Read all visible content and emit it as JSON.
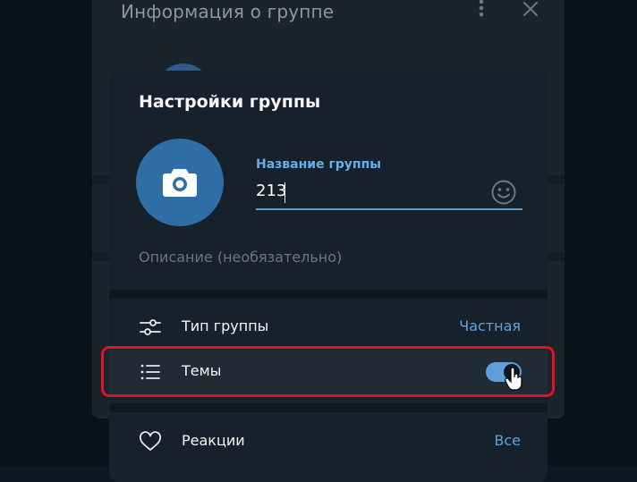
{
  "background_panel": {
    "title": "Информация о группе"
  },
  "dialog": {
    "title": "Настройки группы",
    "name_field": {
      "label": "Название группы",
      "value": "213"
    },
    "description_placeholder": "Описание (необязательно)",
    "rows": [
      {
        "label": "Тип группы",
        "value": "Частная",
        "icon": "sliders-icon"
      },
      {
        "label": "Темы",
        "toggle_on": true,
        "icon": "list-icon"
      },
      {
        "label": "Реакции",
        "value": "Все",
        "icon": "heart-icon"
      }
    ]
  },
  "colors": {
    "accent": "#5ca3e0",
    "avatar": "#2f6ea5",
    "highlight_frame": "#e0141e",
    "dialog_bg": "#17212b"
  }
}
